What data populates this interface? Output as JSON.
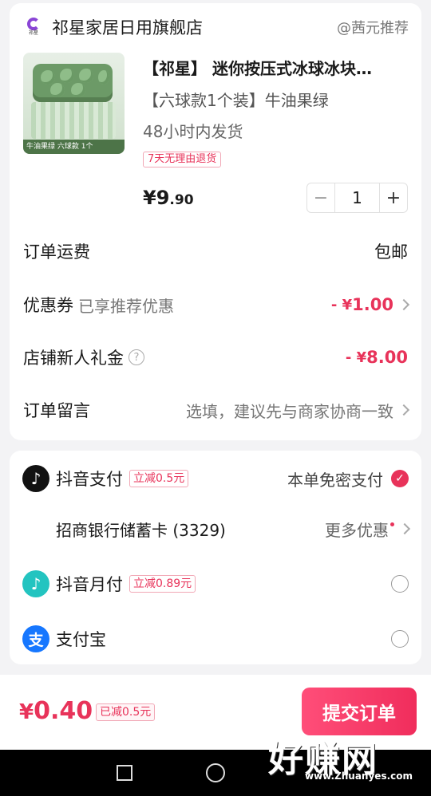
{
  "store": {
    "name": "祁星家居日用旗舰店",
    "logo_text": "祁星",
    "recommender": "@茜元推荐"
  },
  "product": {
    "image_caption": "牛油果绿 六球款 1个",
    "title": "【祁星】 迷你按压式冰球冰块…",
    "variant": "【六球款1个装】牛油果绿",
    "shipping": "48小时内发货",
    "return_policy": "7天无理由退货",
    "price_symbol": "¥",
    "price_int": "9",
    "price_dec": ".90",
    "quantity": "1",
    "minus": "−",
    "plus": "+"
  },
  "order": {
    "freight_label": "订单运费",
    "freight_value": "包邮",
    "coupon_label": "优惠券",
    "coupon_sub": "已享推荐优惠",
    "coupon_value_prefix": "- ¥",
    "coupon_value": "1.00",
    "gift_label": "店铺新人礼金",
    "gift_value_prefix": "- ¥",
    "gift_value": "8.00",
    "note_label": "订单留言",
    "note_placeholder": "选填，建议先与商家协商一致"
  },
  "payment": {
    "douyin_pay": {
      "name": "抖音支付",
      "tag": "立减0.5元",
      "right_label": "本单免密支付",
      "selected": true
    },
    "bank": {
      "name": "招商银行储蓄卡 (3329)",
      "more": "更多优惠"
    },
    "douyin_monthly": {
      "name": "抖音月付",
      "tag": "立减0.89元",
      "selected": false
    },
    "alipay": {
      "name": "支付宝",
      "icon_char": "支",
      "selected": false
    }
  },
  "footer": {
    "total_symbol": "¥",
    "total": "0.40",
    "saved": "已减0.5元",
    "submit": "提交订单"
  },
  "watermark": {
    "main": "好赚网",
    "sub": "www.Zhuanyes.com"
  },
  "colors": {
    "accent": "#e8335a",
    "background": "#f3f3f5"
  }
}
